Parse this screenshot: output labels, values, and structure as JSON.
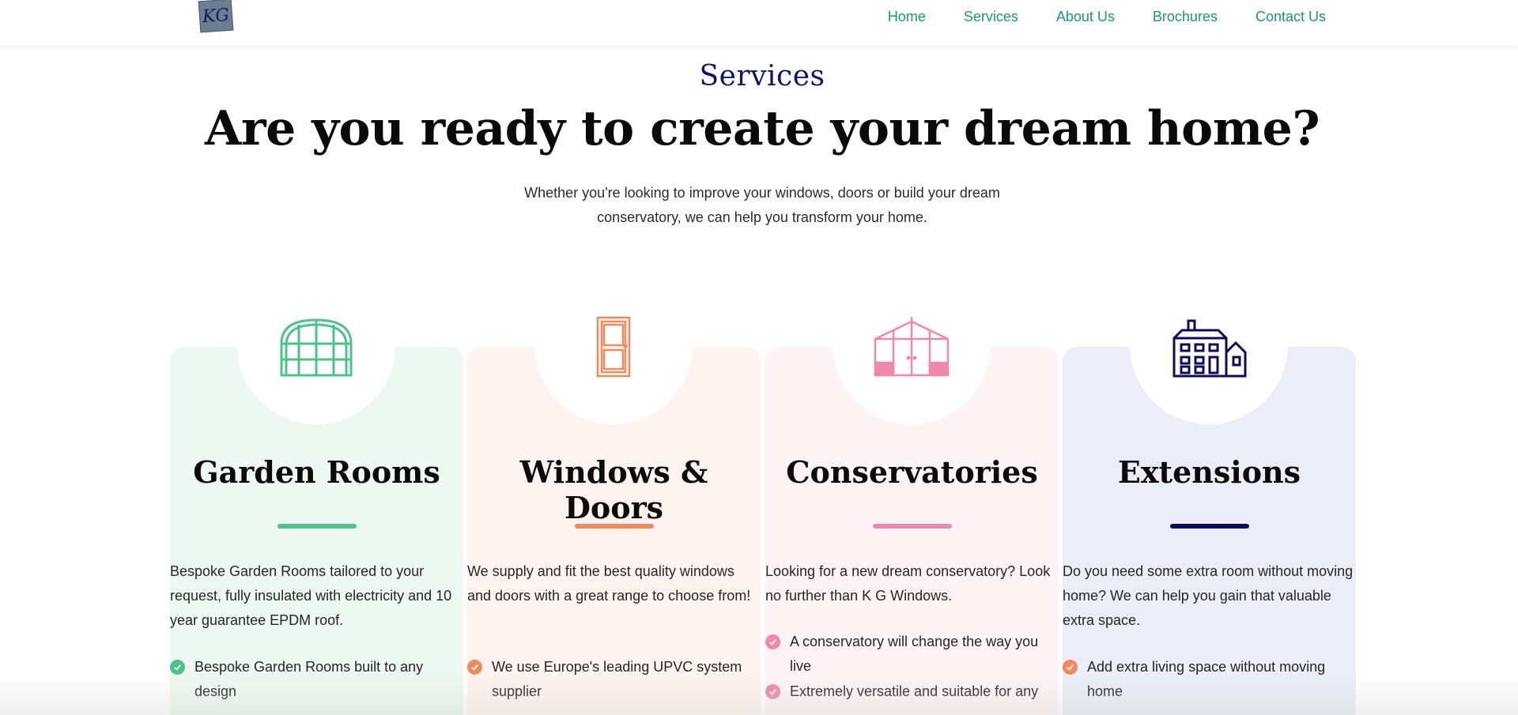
{
  "header": {
    "logo_text": "KG",
    "nav": [
      "Home",
      "Services",
      "About Us",
      "Brochures",
      "Contact Us"
    ]
  },
  "intro": {
    "eyebrow": "Services",
    "headline": "Are you ready to create your dream home?",
    "lead": "Whether you're looking to improve your windows, doors or build your dream conservatory, we can help you transform your home."
  },
  "cards": [
    {
      "title": "Garden Rooms",
      "icon": "arched-window-icon",
      "accent": "#4cc38a",
      "description": "Bespoke Garden Rooms tailored to your request, fully insulated with electricity and 10 year guarantee EPDM roof.",
      "items": [
        "Bespoke Garden Rooms built to any design"
      ]
    },
    {
      "title": "Windows & Doors",
      "icon": "door-icon",
      "accent": "#f28a5b",
      "description": "We supply and fit the best quality windows and doors with a great range to choose from!",
      "items": [
        "We use Europe's leading UPVC system supplier"
      ]
    },
    {
      "title": "Conservatories",
      "icon": "conservatory-icon",
      "accent": "#ef88aa",
      "description": "Looking for a new dream conservatory? Look no further than K G Windows.",
      "items": [
        "A conservatory will change the way you live",
        "Extremely versatile and suitable for any"
      ]
    },
    {
      "title": "Extensions",
      "icon": "house-icon",
      "accent": "#0c0c5c",
      "check_color": "#f28a5b",
      "description": "Do you need some extra room without moving home? We can help you gain that valuable extra space.",
      "items": [
        "Add extra living space without moving home"
      ]
    }
  ]
}
